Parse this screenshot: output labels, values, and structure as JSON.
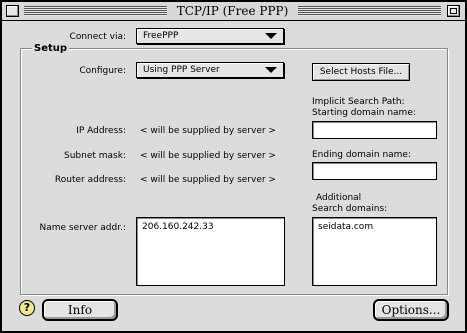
{
  "window": {
    "title": "TCP/IP (Free PPP)"
  },
  "connect": {
    "label": "Connect via:",
    "value": "FreePPP"
  },
  "setup": {
    "title": "Setup",
    "configure_label": "Configure:",
    "configure_value": "Using PPP Server",
    "select_hosts_button": "Select Hosts File...",
    "ip_label": "IP Address:",
    "ip_value": "< will be supplied by server >",
    "subnet_label": "Subnet mask:",
    "subnet_value": "< will be supplied by server >",
    "router_label": "Router address:",
    "router_value": "< will be supplied by server >",
    "nameserver_label": "Name server addr.:",
    "nameserver_value": "206.160.242.33",
    "implicit_label": "Implicit Search Path:",
    "starting_label": "Starting domain name:",
    "starting_value": "",
    "ending_label": "Ending domain name:",
    "ending_value": "",
    "additional_label": "Additional",
    "search_domains_label": "Search domains:",
    "search_domains_value": "seidata.com"
  },
  "footer": {
    "info_button": "Info",
    "options_button": "Options...",
    "help_icon": "?"
  }
}
